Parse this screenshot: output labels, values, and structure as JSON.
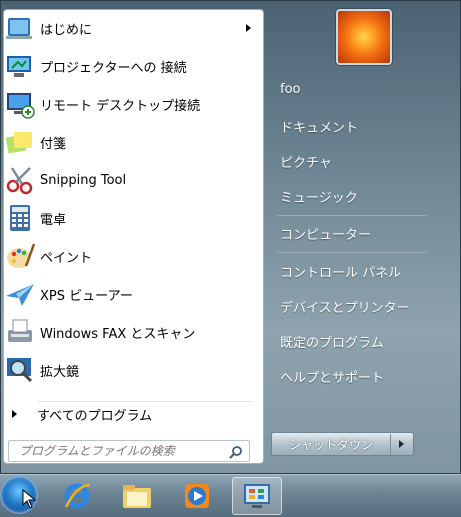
{
  "programs": [
    {
      "label": "はじめに",
      "icon": "getting-started-icon",
      "has_submenu": true
    },
    {
      "label": "プロジェクターへの 接続",
      "icon": "projector-icon",
      "has_submenu": false
    },
    {
      "label": "リモート デスクトップ接続",
      "icon": "remote-desktop-icon",
      "has_submenu": false
    },
    {
      "label": "付箋",
      "icon": "sticky-notes-icon",
      "has_submenu": false
    },
    {
      "label": "Snipping Tool",
      "icon": "scissors-icon",
      "has_submenu": false
    },
    {
      "label": "電卓",
      "icon": "calculator-icon",
      "has_submenu": false
    },
    {
      "label": "ペイント",
      "icon": "paint-palette-icon",
      "has_submenu": false
    },
    {
      "label": "XPS ビューアー",
      "icon": "xps-viewer-icon",
      "has_submenu": false
    },
    {
      "label": "Windows FAX とスキャン",
      "icon": "fax-scanner-icon",
      "has_submenu": false
    },
    {
      "label": "拡大鏡",
      "icon": "magnifier-icon",
      "has_submenu": false
    }
  ],
  "all_programs_label": "すべてのプログラム",
  "search": {
    "placeholder": "プログラムとファイルの検索",
    "value": ""
  },
  "right_items": [
    {
      "label": "foo"
    },
    {
      "label": "ドキュメント"
    },
    {
      "label": "ピクチャ"
    },
    {
      "label": "ミュージック"
    },
    {
      "label": "コンピューター"
    },
    {
      "label": "コントロール パネル"
    },
    {
      "label": "デバイスとプリンター"
    },
    {
      "label": "既定のプログラム"
    },
    {
      "label": "ヘルプとサポート"
    }
  ],
  "shutdown_label": "シャットダウン",
  "taskbar": [
    {
      "icon": "start-orb-icon"
    },
    {
      "icon": "internet-explorer-icon"
    },
    {
      "icon": "file-explorer-icon"
    },
    {
      "icon": "media-player-icon"
    },
    {
      "icon": "control-panel-icon"
    }
  ]
}
